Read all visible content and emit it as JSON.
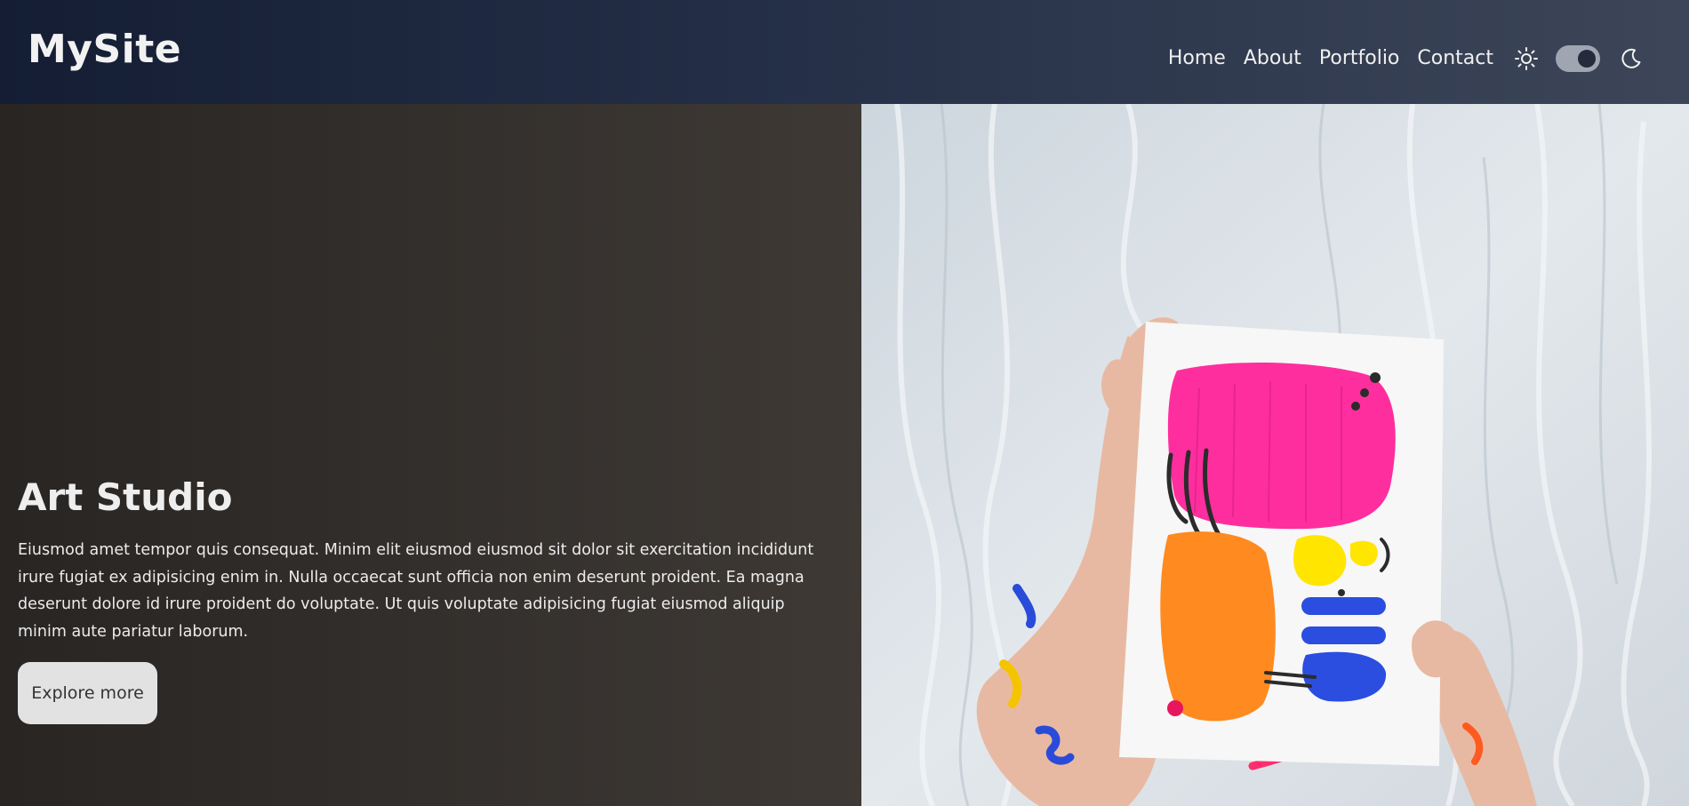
{
  "header": {
    "brand": "MySite",
    "nav": [
      {
        "label": "Home"
      },
      {
        "label": "About"
      },
      {
        "label": "Portfolio"
      },
      {
        "label": "Contact"
      }
    ],
    "theme_toggle": {
      "state": "dark",
      "icons": [
        "sun-icon",
        "moon-icon"
      ]
    }
  },
  "hero": {
    "title": "Art Studio",
    "body": "Eiusmod amet tempor quis consequat. Minim elit eiusmod eiusmod sit dolor sit exercitation incididunt irure fugiat ex adipisicing enim in. Nulla occaecat sunt officia non enim deserunt proident. Ea magna deserunt dolore id irure proident do voluptate. Ut quis voluptate adipisicing fugiat eiusmod aliquip minim aute pariatur laborum.",
    "cta_label": "Explore more"
  },
  "colors": {
    "header_start": "#141d33",
    "header_end": "#3d4658",
    "hero_panel": "#34302d",
    "text_light": "#eeeeee",
    "button_bg": "#e2e2e2"
  }
}
